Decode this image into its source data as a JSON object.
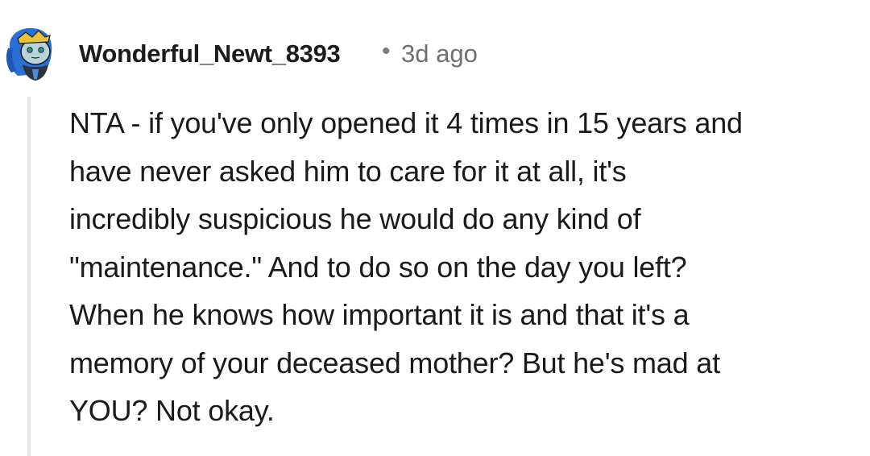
{
  "comment": {
    "username": "Wonderful_Newt_8393",
    "separator": "•",
    "timestamp": "3d ago",
    "avatar_icon": "snoo-avatar-icon",
    "body_lines": [
      "NTA - if you've only opened it 4 times in 15 years and",
      "have never asked him to care for it at all, it's",
      "incredibly suspicious he would do any kind of",
      "\"maintenance.\" And to do so on the day you left?",
      "When he knows how important it is and that it's a",
      "memory of your deceased mother? But he's mad at",
      "YOU? Not okay."
    ]
  },
  "colors": {
    "avatar_hair": "#2a6fd6",
    "avatar_face": "#b9d3dc",
    "avatar_crown": "#e8c23a",
    "thread_line": "#e6e6e6"
  }
}
